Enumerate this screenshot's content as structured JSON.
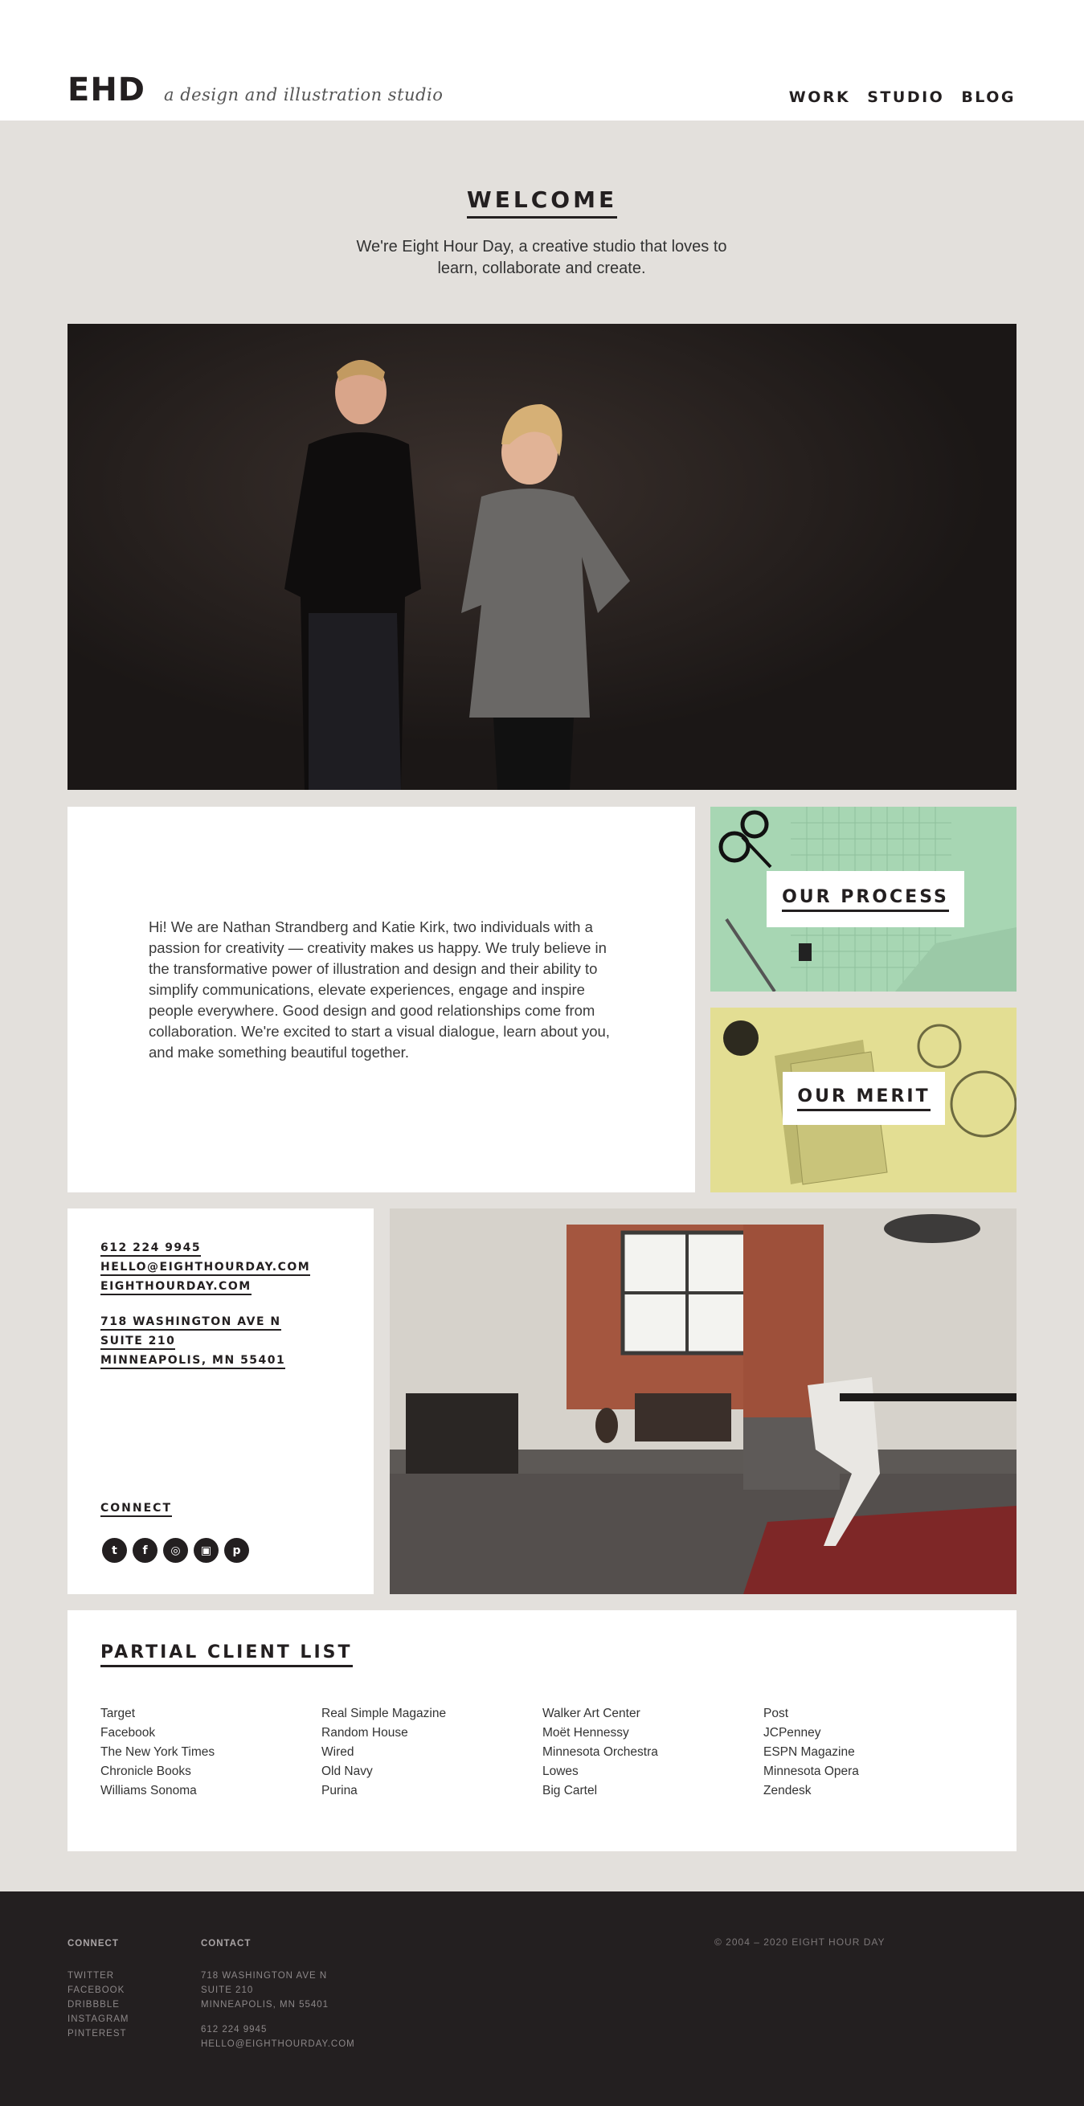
{
  "header": {
    "logo": "EHD",
    "tagline": "a design and illustration studio",
    "nav": [
      "WORK",
      "STUDIO",
      "BLOG"
    ]
  },
  "welcome": {
    "title": "WELCOME",
    "text": "We're Eight Hour Day, a creative studio that loves to learn, collaborate and create."
  },
  "intro": {
    "text": "Hi! We are Nathan Strandberg and Katie Kirk, two individuals with a passion for creativity — creativity makes us happy. We truly believe in the transformative power of illustration and design and their ability to simplify communications, elevate experiences, engage and inspire people everywhere. Good design and good relationships come from collaboration. We're excited to start a visual dialogue, learn about you, and make something beautiful together."
  },
  "tiles": {
    "process": "OUR PROCESS",
    "merit": "OUR MERIT"
  },
  "contact": {
    "phone": "612 224 9945",
    "email": "HELLO@EIGHTHOURDAY.COM",
    "website": "EIGHTHOURDAY.COM",
    "address": [
      "718 WASHINGTON AVE N",
      "SUITE 210",
      "MINNEAPOLIS, MN 55401"
    ],
    "connect": "CONNECT",
    "social_icons": [
      "twitter-icon",
      "facebook-icon",
      "dribbble-icon",
      "instagram-icon",
      "pinterest-icon"
    ]
  },
  "clients": {
    "title": "PARTIAL CLIENT LIST",
    "columns": [
      [
        "Target",
        "Facebook",
        "The New York Times",
        "Chronicle Books",
        "Williams Sonoma"
      ],
      [
        "Real Simple Magazine",
        "Random House",
        "Wired",
        "Old Navy",
        "Purina"
      ],
      [
        "Walker Art Center",
        "Moët Hennessy",
        "Minnesota Orchestra",
        "Lowes",
        "Big Cartel"
      ],
      [
        "Post",
        "JCPenney",
        "ESPN Magazine",
        "Minnesota Opera",
        "Zendesk"
      ]
    ]
  },
  "footer": {
    "connect_title": "CONNECT",
    "connect_links": [
      "TWITTER",
      "FACEBOOK",
      "DRIBBBLE",
      "INSTAGRAM",
      "PINTEREST"
    ],
    "contact_title": "CONTACT",
    "address": [
      "718 WASHINGTON AVE N",
      "SUITE 210",
      "MINNEAPOLIS, MN 55401"
    ],
    "phone": "612 224 9945",
    "email": "HELLO@EIGHTHOURDAY.COM",
    "copyright": "© 2004 – 2020 EIGHT HOUR DAY"
  },
  "colors": {
    "dark": "#231f20",
    "background": "#e3e0dc",
    "process_tile": "#a7d6b3",
    "merit_tile": "#e3de93"
  }
}
